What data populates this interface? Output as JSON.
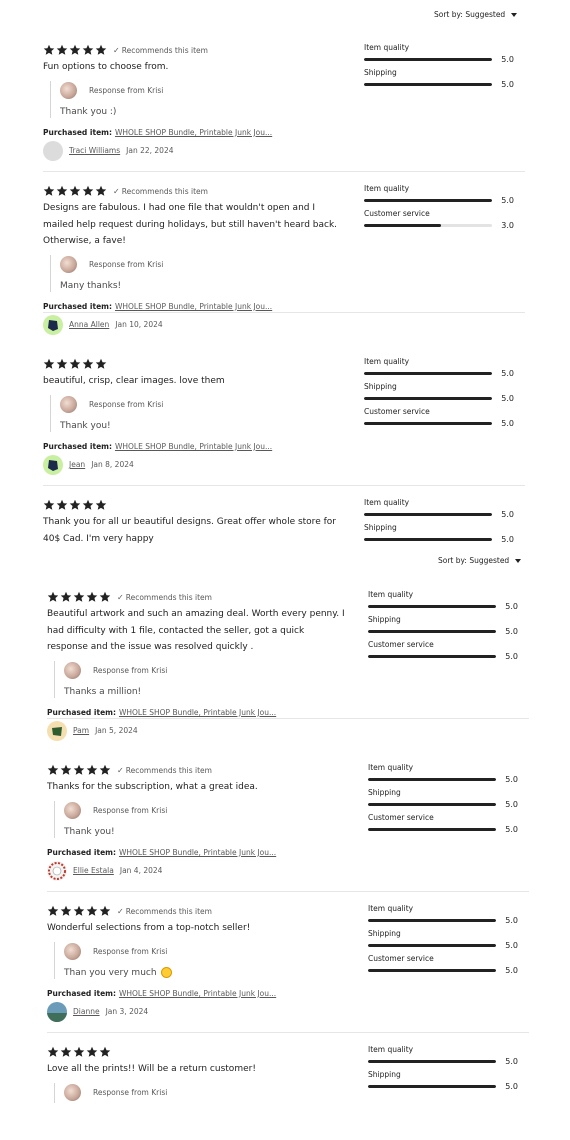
{
  "sort_top": {
    "label": "Sort by: Suggested"
  },
  "sort_mid": {
    "label": "Sort by: Suggested"
  },
  "reviews": [
    {
      "stars": 5,
      "recommends": "Recommends this item",
      "text": "Fun options to choose from.",
      "response": {
        "from": "Response from Krisi",
        "text": "Thank you :)"
      },
      "purchased_label": "Purchased item:",
      "purchased_item": "WHOLE SHOP Bundle, Printable Junk Jou...",
      "reviewer": "Traci Williams",
      "date": "Jan 22, 2024",
      "avatar_color": "#dcdcdc",
      "ratings": [
        {
          "label": "Item quality",
          "value": "5.0",
          "fill": 1.0
        },
        {
          "label": "Shipping",
          "value": "5.0",
          "fill": 1.0
        }
      ]
    },
    {
      "stars": 5,
      "recommends": "Recommends this item",
      "text": "Designs are fabulous. I had one file that wouldn't open and I mailed help request during holidays, but still haven't heard back. Otherwise, a fave!",
      "response": {
        "from": "Response from Krisi",
        "text": "Many thanks!"
      },
      "purchased_label": "Purchased item:",
      "purchased_item": "WHOLE SHOP Bundle, Printable Junk Jou...",
      "reviewer": "Anna Allen",
      "date": "Jan 10, 2024",
      "avatar_color": "#c8f0a0",
      "ratings": [
        {
          "label": "Item quality",
          "value": "5.0",
          "fill": 1.0
        },
        {
          "label": "Customer service",
          "value": "3.0",
          "fill": 0.6
        }
      ]
    },
    {
      "stars": 5,
      "recommends": "",
      "text": "beautiful, crisp, clear images. love them",
      "response": {
        "from": "Response from Krisi",
        "text": "Thank you!"
      },
      "purchased_label": "Purchased item:",
      "purchased_item": "WHOLE SHOP Bundle, Printable Junk Jou...",
      "reviewer": "Jean",
      "date": "Jan 8, 2024",
      "avatar_color": "#c8f0a0",
      "ratings": [
        {
          "label": "Item quality",
          "value": "5.0",
          "fill": 1.0
        },
        {
          "label": "Shipping",
          "value": "5.0",
          "fill": 1.0
        },
        {
          "label": "Customer service",
          "value": "5.0",
          "fill": 1.0
        }
      ]
    },
    {
      "stars": 5,
      "recommends": "",
      "text": "Thank you for all ur beautiful designs. Great offer whole store for 40$ Cad. I'm very happy",
      "ratings": [
        {
          "label": "Item quality",
          "value": "5.0",
          "fill": 1.0
        },
        {
          "label": "Shipping",
          "value": "5.0",
          "fill": 1.0
        }
      ]
    },
    {
      "stars": 5,
      "recommends": "Recommends this item",
      "text": "Beautiful artwork and such an amazing deal. Worth every penny. I had difficulty with 1 file, contacted the seller, got a quick response and the issue was resolved quickly .",
      "response": {
        "from": "Response from Krisi",
        "text": "Thanks a million!"
      },
      "purchased_label": "Purchased item:",
      "purchased_item": "WHOLE SHOP Bundle, Printable Junk Jou...",
      "reviewer": "Pam",
      "date": "Jan 5, 2024",
      "avatar_color": "#f5dfb0",
      "ratings": [
        {
          "label": "Item quality",
          "value": "5.0",
          "fill": 1.0
        },
        {
          "label": "Shipping",
          "value": "5.0",
          "fill": 1.0
        },
        {
          "label": "Customer service",
          "value": "5.0",
          "fill": 1.0
        }
      ]
    },
    {
      "stars": 5,
      "recommends": "Recommends this item",
      "text": "Thanks for the subscription, what a great idea.",
      "response": {
        "from": "Response from Krisi",
        "text": "Thank you!"
      },
      "purchased_label": "Purchased item:",
      "purchased_item": "WHOLE SHOP Bundle, Printable Junk Jou...",
      "reviewer": "Ellie Estala",
      "date": "Jan 4, 2024",
      "avatar_color": "#f3f3f3",
      "ratings": [
        {
          "label": "Item quality",
          "value": "5.0",
          "fill": 1.0
        },
        {
          "label": "Shipping",
          "value": "5.0",
          "fill": 1.0
        },
        {
          "label": "Customer service",
          "value": "5.0",
          "fill": 1.0
        }
      ]
    },
    {
      "stars": 5,
      "recommends": "Recommends this item",
      "text": "Wonderful selections from a top-notch seller!",
      "response": {
        "from": "Response from Krisi",
        "text": "Than you very much"
      },
      "purchased_label": "Purchased item:",
      "purchased_item": "WHOLE SHOP Bundle, Printable Junk Jou...",
      "reviewer": "Dianne",
      "date": "Jan 3, 2024",
      "avatar_color": "#6a9bb8",
      "ratings": [
        {
          "label": "Item quality",
          "value": "5.0",
          "fill": 1.0
        },
        {
          "label": "Shipping",
          "value": "5.0",
          "fill": 1.0
        },
        {
          "label": "Customer service",
          "value": "5.0",
          "fill": 1.0
        }
      ]
    },
    {
      "stars": 5,
      "recommends": "",
      "text": "Love all the prints!! Will be a return customer!",
      "response": {
        "from": "Response from Krisi",
        "text": ""
      },
      "ratings": [
        {
          "label": "Item quality",
          "value": "5.0",
          "fill": 1.0
        },
        {
          "label": "Shipping",
          "value": "5.0",
          "fill": 1.0
        }
      ]
    }
  ]
}
